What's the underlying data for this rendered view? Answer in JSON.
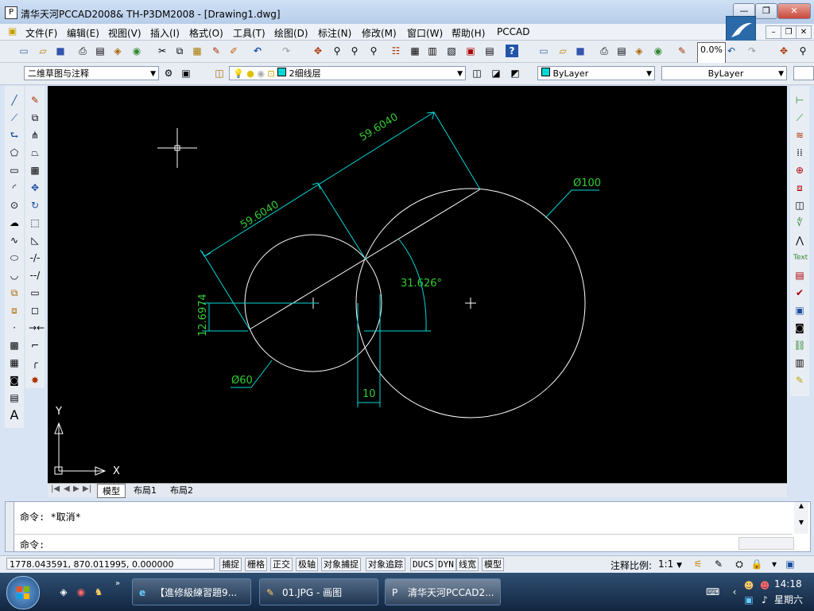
{
  "window": {
    "title": "清华天河PCCAD2008& TH-P3DM2008 - [Drawing1.dwg]"
  },
  "menu": [
    "文件(F)",
    "编辑(E)",
    "视图(V)",
    "插入(I)",
    "格式(O)",
    "工具(T)",
    "绘图(D)",
    "标注(N)",
    "修改(M)",
    "窗口(W)",
    "帮助(H)",
    "PCCAD"
  ],
  "toolbar": {
    "zoom_value": "0.0%"
  },
  "props": {
    "workspace": "二维草图与注释",
    "layer": "2细线层",
    "color": "ByLayer",
    "linetype": "ByLayer"
  },
  "colors": {
    "accent": "#00d8d8",
    "dim_text": "#33cc33",
    "geometry": "#ffffff",
    "canvas": "#000000"
  },
  "drawing": {
    "dim_upper": "59.6040",
    "dim_lower": "59.6040",
    "dim_dia_large": "Ø100",
    "dim_dia_small": "Ø60",
    "dim_angle": "31.626°",
    "dim_vertical": "12.6974",
    "dim_width": "10",
    "ucs_x": "X",
    "ucs_y": "Y"
  },
  "layout_tabs": [
    "模型",
    "布局1",
    "布局2"
  ],
  "command": {
    "line1": "命令: *取消*",
    "line2": "命令:"
  },
  "status": {
    "coords": "1778.043591,  870.011995,  0.000000",
    "buttons": [
      "捕捉",
      "栅格",
      "正交",
      "极轴",
      "对象捕捉",
      "对象追踪",
      "DUCS",
      "DYN",
      "线宽",
      "模型"
    ],
    "annotation_scale_label": "注释比例:",
    "annotation_scale": "1:1"
  },
  "taskbar": {
    "items": [
      "【進修級練習題9...",
      "01.JPG - 画图",
      "清华天河PCCAD2..."
    ],
    "time": "14:18",
    "day": "星期六"
  }
}
